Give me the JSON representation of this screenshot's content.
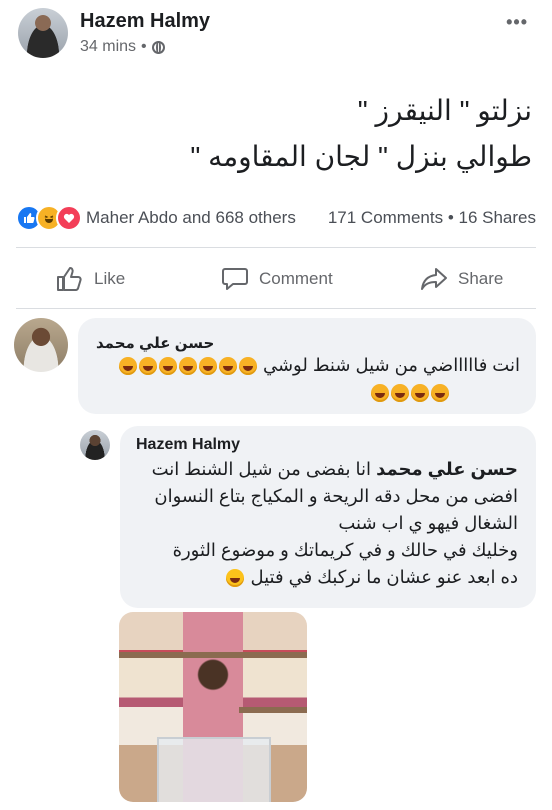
{
  "post": {
    "author": "Hazem Halmy",
    "time": "34 mins",
    "separator": "•",
    "more": "•••",
    "text_lines": [
      "نزلتو \" النيقرز \"",
      "طوالي بنزل \" لجان المقاومه \""
    ]
  },
  "reactions": {
    "summary": "Maher Abdo and 668 others",
    "stats": "171 Comments • 16 Shares",
    "icons": [
      "like-icon",
      "haha-icon",
      "love-icon"
    ]
  },
  "actions": {
    "like": "Like",
    "comment": "Comment",
    "share": "Share"
  },
  "comments": [
    {
      "author": "حسن علي محمد",
      "text": "انت فاااااضي من شيل شنط لوشي",
      "emoji_count": 11
    },
    {
      "author": "Hazem Halmy",
      "mention": "حسن علي محمد",
      "lines": [
        "انا بفضى من شيل الشنط انت",
        "افضى من محل دقه الريحة و المكياج بتاع النسوان",
        "الشغال فيهو ي اب شنب",
        "وخليك في حالك و في كريماتك و موضوع الثورة",
        "ده ابعد عنو عشان ما نركبك في فتيل"
      ]
    }
  ],
  "colors": {
    "like_blue": "#1877f2",
    "haha_yellow": "#f7b125",
    "love_red": "#f33e58"
  }
}
